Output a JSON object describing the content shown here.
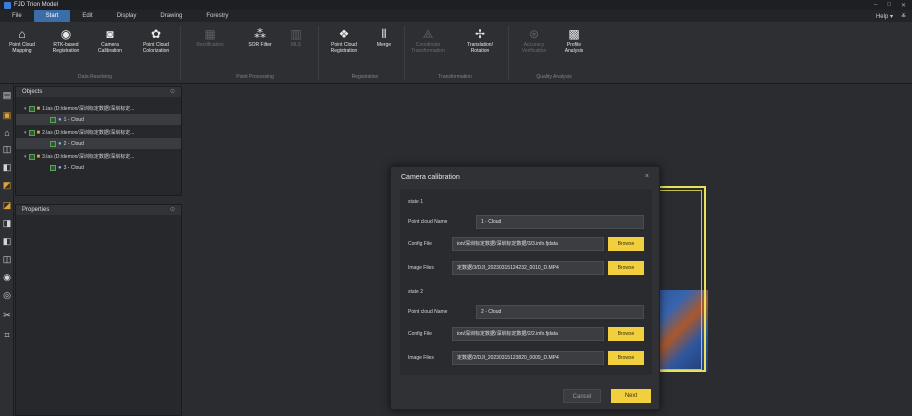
{
  "app": {
    "title": "FJD Trion Model"
  },
  "window_controls": {
    "minimize": "–",
    "maximize": "□",
    "close": "✕"
  },
  "menu": [
    "File",
    "Start",
    "Edit",
    "Display",
    "Drawing",
    "Forestry"
  ],
  "help": {
    "label": "Help ▾",
    "extra": "≚"
  },
  "ribbon": {
    "tools": [
      {
        "label": "Point Cloud\nMapping",
        "icon": "scanner-icon"
      },
      {
        "label": "RTK-based\nRegistration",
        "icon": "rtk-icon"
      },
      {
        "label": "Camera\nCalibration",
        "icon": "camera-icon"
      },
      {
        "label": "Point Cloud\nColorization",
        "icon": "palette-icon"
      },
      {
        "label": "Rectification",
        "icon": "rectify-icon"
      },
      {
        "label": "SOR Filter",
        "icon": "filter-icon"
      },
      {
        "label": "MLS",
        "icon": "mls-icon"
      },
      {
        "label": "Point Cloud\nRegistration",
        "icon": "registration-icon"
      },
      {
        "label": "Merge",
        "icon": "merge-icon"
      },
      {
        "label": "Coordinate\nTransformation",
        "icon": "coordinate-icon"
      },
      {
        "label": "Translation/\nRotation",
        "icon": "translate-icon"
      },
      {
        "label": "Accuracy\nVerification",
        "icon": "accuracy-icon"
      },
      {
        "label": "Profile\nAnalysis",
        "icon": "profile-icon"
      }
    ],
    "groups": [
      "Data Resolving",
      "Point Processing",
      "Registration",
      "Transformation",
      "Quality Analysis"
    ]
  },
  "objects_panel": {
    "title": "Objects",
    "items": [
      {
        "text": "1.las (D:/demon/深圳标定数据/深圳标定...",
        "level": 0
      },
      {
        "text": "1 - Cloud",
        "level": 1
      },
      {
        "text": "2.las (D:/demon/深圳标定数据/深圳标定...",
        "level": 0
      },
      {
        "text": "2 - Cloud",
        "level": 1
      },
      {
        "text": "3.las (D:/demon/深圳标定数据/深圳标定...",
        "level": 0
      },
      {
        "text": "3 - Cloud",
        "level": 1
      }
    ]
  },
  "properties_panel": {
    "title": "Properties"
  },
  "dialog": {
    "title": "Camera calibration",
    "close": "×",
    "state1": {
      "heading": "state 1",
      "pc_label": "Point cloud Name",
      "pc_value": "1 - Cloud",
      "config_label": "Config File",
      "config_value": "ion/深圳标定数据/深圳标定数据/3/3.info.fjdata",
      "image_label": "Image Files",
      "image_value": "定数据/3/DJI_20230315124232_0010_D.MP4",
      "browse": "Browse"
    },
    "state2": {
      "heading": "state 2",
      "pc_label": "Point cloud Name",
      "pc_value": "2 - Cloud",
      "config_label": "Config File",
      "config_value": "ion/深圳标定数据/深圳标定数据/2/2.info.fjdata",
      "image_label": "Image Files",
      "image_value": "定数据/2/DJI_20230315123820_0009_D.MP4",
      "browse": "Browse"
    },
    "cancel": "Cancel",
    "next": "Next"
  },
  "colors": {
    "accent": "#3b6ea8",
    "button_yellow": "#f2cf3c",
    "folder": "#e0a238"
  }
}
